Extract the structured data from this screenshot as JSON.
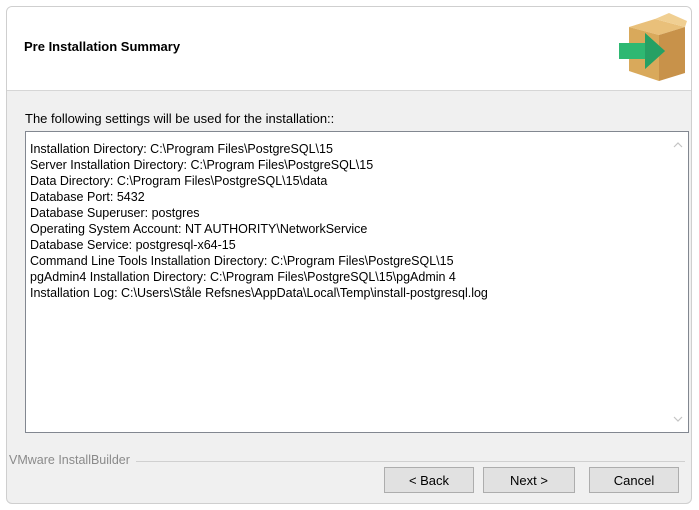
{
  "header": {
    "title": "Pre Installation Summary",
    "logo_icon": "installer-box-arrow-icon"
  },
  "main": {
    "intro": "The following settings will be used for the installation::",
    "summary_lines": [
      "Installation Directory: C:\\Program Files\\PostgreSQL\\15",
      "Server Installation Directory: C:\\Program Files\\PostgreSQL\\15",
      "Data Directory: C:\\Program Files\\PostgreSQL\\15\\data",
      "Database Port: 5432",
      "Database Superuser: postgres",
      "Operating System Account: NT AUTHORITY\\NetworkService",
      "Database Service: postgresql-x64-15",
      "Command Line Tools Installation Directory: C:\\Program Files\\PostgreSQL\\15",
      "pgAdmin4 Installation Directory: C:\\Program Files\\PostgreSQL\\15\\pgAdmin 4",
      "Installation Log: C:\\Users\\Ståle Refsnes\\AppData\\Local\\Temp\\install-postgresql.log"
    ]
  },
  "footer": {
    "brand": "VMware InstallBuilder",
    "back_label": "< Back",
    "next_label": "Next >",
    "cancel_label": "Cancel"
  },
  "colors": {
    "box_brown": "#d9a95b",
    "arrow_green": "#2eb872",
    "window_bg": "#f0f0f0"
  }
}
